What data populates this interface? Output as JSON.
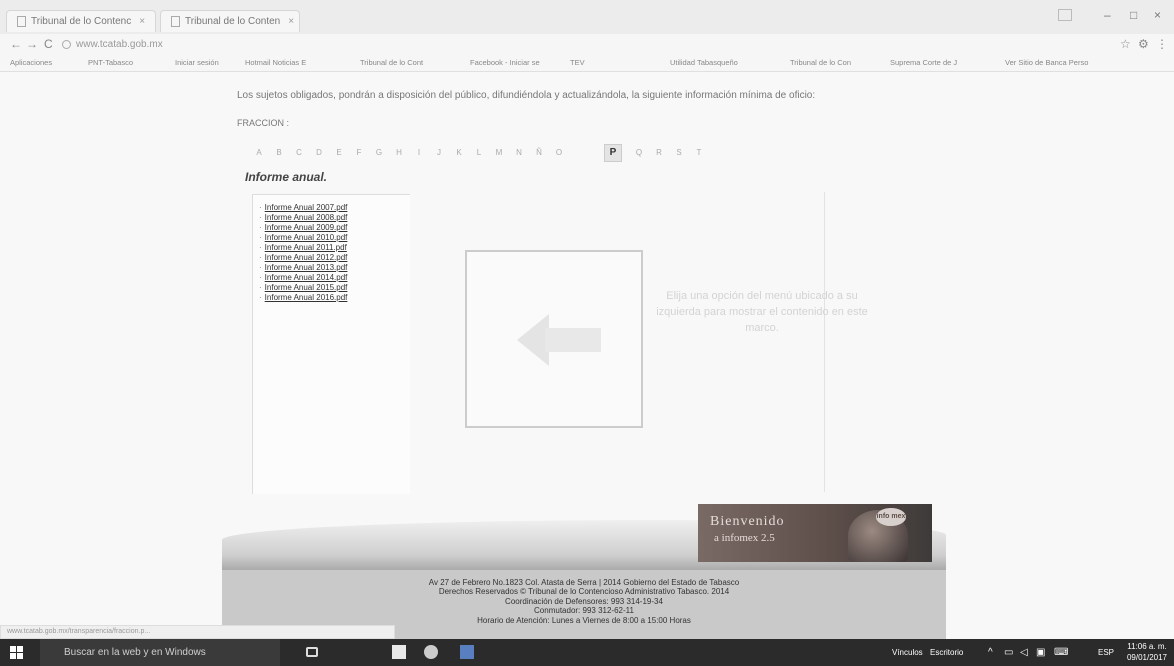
{
  "browser": {
    "tabs": [
      {
        "label": "Tribunal de lo Contenc"
      },
      {
        "label": "Tribunal de lo Conten"
      }
    ],
    "window_controls": {
      "minimize": "–",
      "maximize": "□",
      "close": "×"
    },
    "nav": {
      "back": "←",
      "forward": "→",
      "reload": "C"
    },
    "url": "www.tcatab.gob.mx",
    "bookmarks": [
      "Aplicaciones",
      "PNT-Tabasco",
      "Iniciar sesión",
      "Hotmail Noticias E",
      "Tribunal de lo Cont",
      "Facebook - Iniciar se",
      "TEV",
      "Utilidad Tabasqueño",
      "Tribunal de lo Con",
      "Suprema Corte de J",
      "Ver Sitio de Banca Perso"
    ]
  },
  "page": {
    "intro": "Los sujetos obligados, pondrán a disposición del público, difundiéndola y actualizándola, la siguiente información mínima de oficio:",
    "fraccion_label": "FRACCION :",
    "letters": [
      "A",
      "B",
      "C",
      "D",
      "E",
      "F",
      "G",
      "H",
      "I",
      "J",
      "K",
      "L",
      "M",
      "N",
      "Ñ",
      "O",
      "P",
      "Q",
      "R",
      "S",
      "T"
    ],
    "active_letter": "P",
    "section_title": "Informe anual.",
    "reports": [
      "Informe Anual 2007.pdf",
      "Informe Anual 2008.pdf",
      "Informe Anual 2009.pdf",
      "Informe Anual 2010.pdf",
      "Informe Anual 2011.pdf",
      "Informe Anual 2012.pdf",
      "Informe Anual 2013.pdf",
      "Informe Anual 2014.pdf",
      "Informe Anual 2015.pdf",
      "Informe Anual 2016.pdf"
    ],
    "hint": "Elija una opción del menú ubicado a su izquierda para mostrar el contenido en este marco.",
    "banner": {
      "line1": "Bienvenido",
      "line2": "a infomex 2.5",
      "logo": "info mex"
    },
    "footer": [
      "Av 27 de Febrero No.1823 Col. Atasta de Serra | 2014 Gobierno del Estado de Tabasco",
      "Derechos Reservados © Tribunal de lo Contencioso Administrativo Tabasco. 2014",
      "Coordinación de Defensores: 993 314-19-34",
      "Conmutador: 993 312-62-11",
      "Horario de Atención: Lunes a Viernes de 8:00 a 15:00 Horas"
    ],
    "status_url": "www.tcatab.gob.mx/transparencia/fraccion.p..."
  },
  "taskbar": {
    "search_placeholder": "Buscar en la web y en Windows",
    "tray_vinculos": "Vínculos",
    "tray_escritorio": "Escritorio",
    "tray_lang": "ESP",
    "time": "11:06 a. m.",
    "date": "09/01/2017"
  }
}
